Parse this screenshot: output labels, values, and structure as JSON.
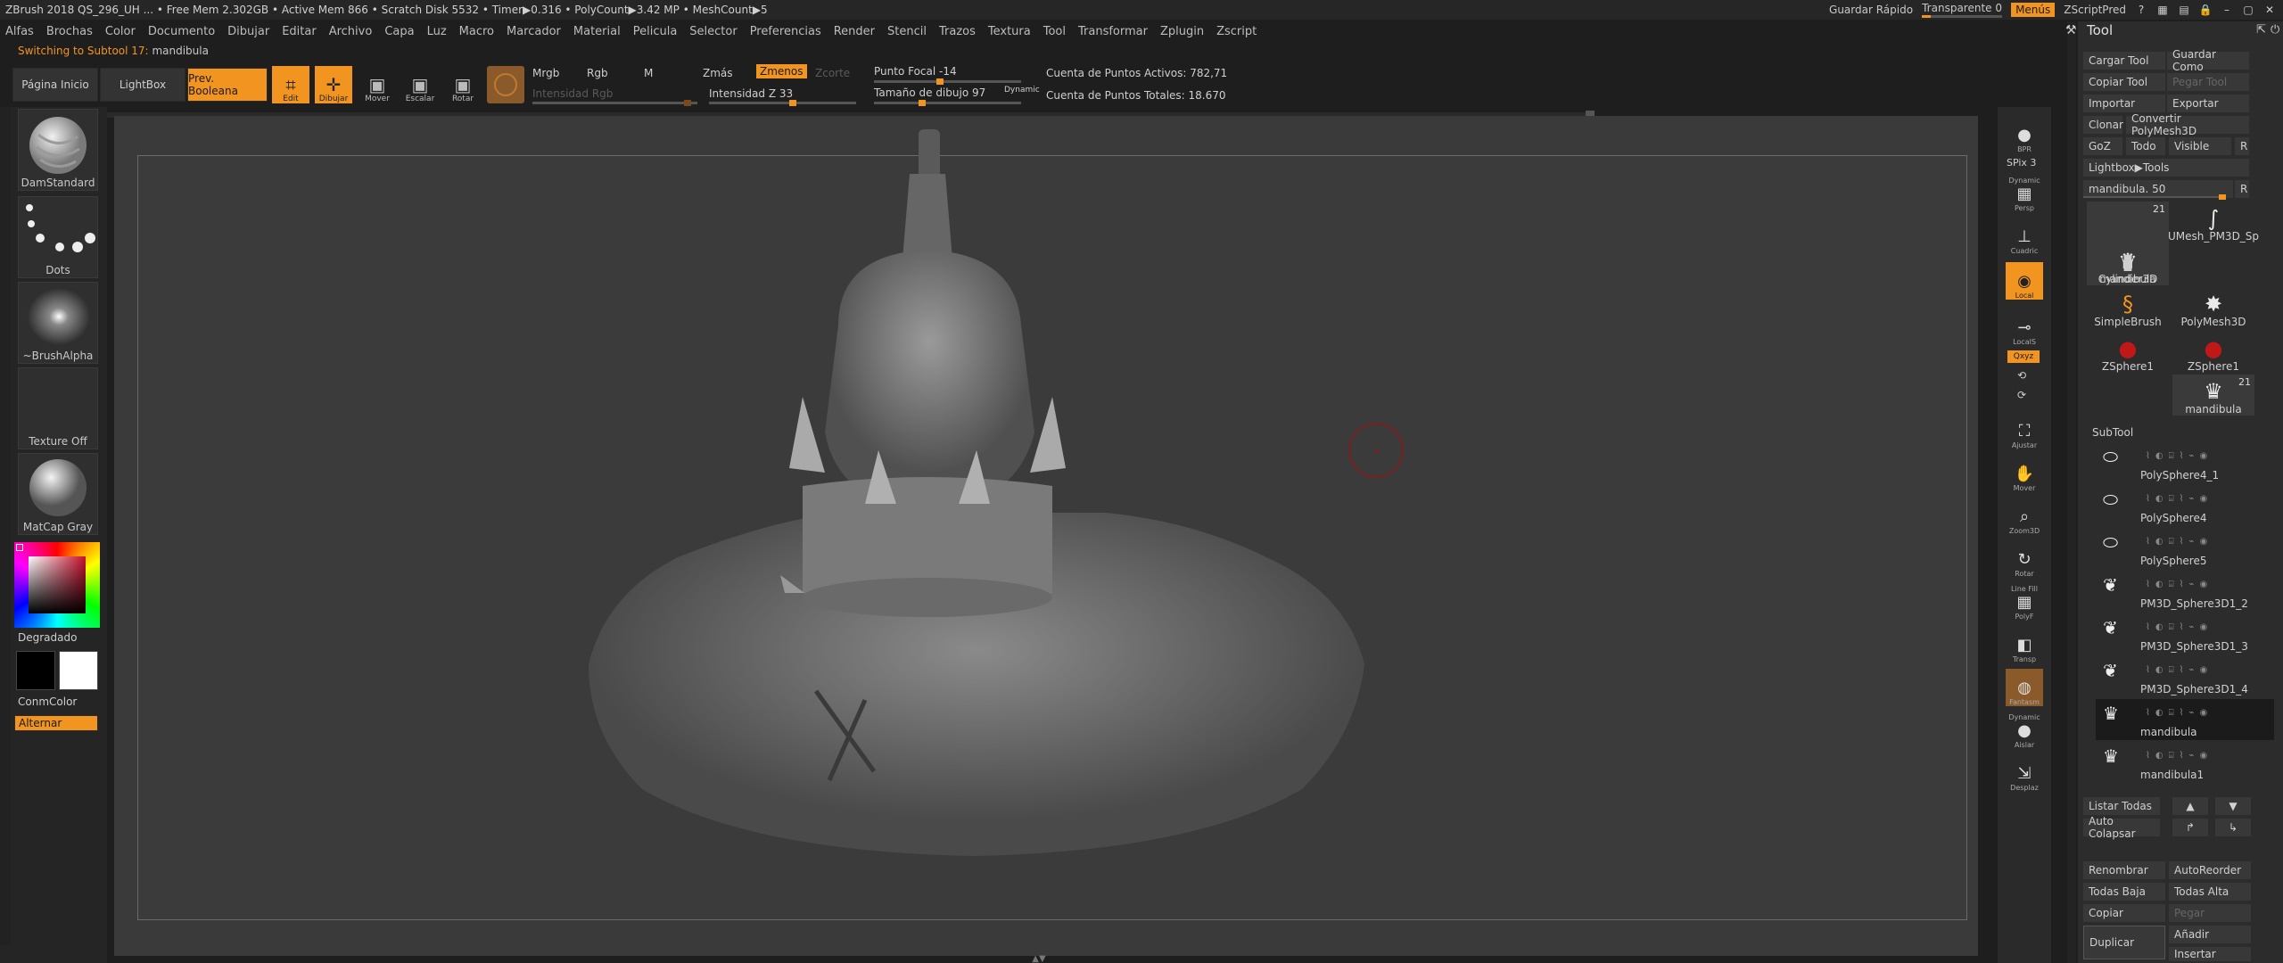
{
  "titlebar": {
    "info": "ZBrush 2018   QS_296_UH   ... • Free Mem 2.302GB • Active Mem 866 • Scratch Disk 5532 •  Timer▶0.316 • PolyCount▶3.42 MP  • MeshCount▶5",
    "quick_save": "Guardar Rápido",
    "transparent": "Transparente 0",
    "transparent_level": 0,
    "menus": "Menús",
    "default_script": "ZScriptPred"
  },
  "menubar": {
    "items": [
      "Alfas",
      "Brochas",
      "Color",
      "Documento",
      "Dibujar",
      "Editar",
      "Archivo",
      "Capa",
      "Luz",
      "Macro",
      "Marcador",
      "Material",
      "Pelicula",
      "Selector",
      "Preferencias",
      "Render",
      "Stencil",
      "Trazos",
      "Textura",
      "Tool",
      "Transformar",
      "Zplugin",
      "Zscript"
    ]
  },
  "status": {
    "prefix": "Switching to Subtool 17:",
    "subtool": "mandibula"
  },
  "toolbar": {
    "home_page": "Página Inicio",
    "lightbox": "LightBox",
    "boolean_preview": "Prev. Booleana",
    "edit": "Edit",
    "draw": "Dibujar",
    "move": "Mover",
    "scale": "Escalar",
    "rotate": "Rotar",
    "mrgb": "Mrgb",
    "rgb": "Rgb",
    "m": "M",
    "zadd": "Zmás",
    "zsub": "Zmenos",
    "zcut": "Zcorte",
    "rgb_intensity": "Intensidad Rgb",
    "z_intensity": "Intensidad Z 33",
    "z_intensity_value": 33,
    "focal_shift": "Punto Focal -14",
    "focal_shift_value": -14,
    "draw_size": "Tamaño de dibujo 97",
    "draw_size_value": 97,
    "dynamic": "Dynamic",
    "active_points": "Cuenta de Puntos Activos: 782,71",
    "total_points": "Cuenta de Puntos Totales: 18.670"
  },
  "leftshelf": {
    "brush": "DamStandard",
    "stroke": "Dots",
    "alpha": "~BrushAlpha",
    "texture": "Texture Off",
    "material": "MatCap Gray",
    "gradient": "Degradado",
    "conm_color": "ConmColor",
    "alternate": "Alternar"
  },
  "rightshelf": {
    "bpr": "BPR",
    "spix": "SPix 3",
    "dynamic": "Dynamic",
    "persp": "Persp",
    "floor": "Cuadric",
    "local": "Local",
    "locals": "LocalS",
    "xyz": "Qxyz",
    "frame": "Ajustar",
    "move": "Mover",
    "zoom3d": "Zoom3D",
    "rotate": "Rotar",
    "linefill": "Line Fill",
    "polyf": "PolyF",
    "transp": "Transp",
    "solo": "Fantasm",
    "dynamic2": "Dynamic",
    "solo2": "Aislar",
    "xpose": "Desplaz"
  },
  "panel": {
    "title": "Tool",
    "load_tool": "Cargar Tool",
    "save_as": "Guardar Como",
    "copy_tool": "Copiar Tool",
    "paste_tool": "Pegar Tool",
    "import": "Importar",
    "export": "Exportar",
    "clone": "Clonar",
    "make_polymesh": "Convertir PolyMesh3D",
    "goz": "GoZ",
    "all": "Todo",
    "visible": "Visible",
    "r": "R",
    "lightbox_tools": "Lightbox▶Tools",
    "current_tool": "mandibula. 50",
    "current_tool_value": 50,
    "tools": [
      {
        "name": "mandibula",
        "badge": "21",
        "icon": "jaw-icon"
      },
      {
        "name": "UMesh_PM3D_Sp",
        "badge": "",
        "icon": "curve-icon"
      },
      {
        "name": "Cylinder3D",
        "badge": "",
        "icon": "cylinder-icon"
      },
      {
        "name": "PolyMesh3D",
        "badge": "",
        "icon": "star-icon"
      },
      {
        "name": "SimpleBrush",
        "badge": "",
        "icon": "s-brush-icon"
      },
      {
        "name": "ZSphere1",
        "badge": "",
        "icon": "zsphere-icon"
      },
      {
        "name": "ZSphere1",
        "badge": "",
        "icon": "zsphere-icon"
      },
      {
        "name": "mandibula",
        "badge": "21",
        "icon": "jaw-icon"
      }
    ],
    "subtool_title": "SubTool",
    "subtools": [
      "PolySphere4_1",
      "PolySphere4",
      "PolySphere5",
      "PM3D_Sphere3D1_2",
      "PM3D_Sphere3D1_3",
      "PM3D_Sphere3D1_4",
      "mandibula",
      "mandibula1"
    ],
    "list_all": "Listar Todas",
    "auto_collapse": "Auto Colapsar",
    "rename": "Renombrar",
    "auto_reorder": "AutoReorder",
    "all_low": "Todas Baja",
    "all_high": "Todas Alta",
    "copy": "Copiar",
    "paste": "Pegar",
    "duplicate": "Duplicar",
    "append": "Añadir",
    "insert": "Insertar"
  },
  "colors": {
    "accent": "#f29420",
    "background": "#3a3a3a"
  }
}
